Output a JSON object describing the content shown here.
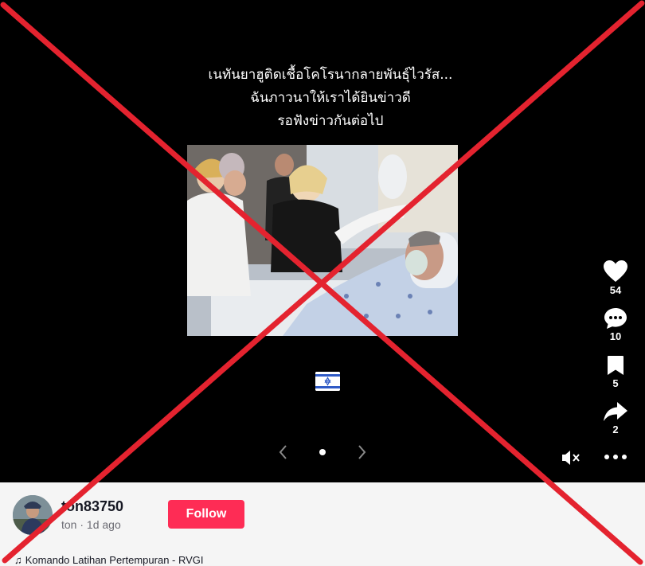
{
  "post": {
    "caption_lines": [
      "เนทันยาฮูติดเชื้อโคโรนากลายพันธุ์ไวรัส...",
      "ฉันภาวนาให้เราได้ยินข่าวดี",
      "รอฟังข่าวกันต่อไป"
    ],
    "flag_icon": "israel-flag-icon"
  },
  "actions": {
    "likes": "54",
    "comments": "10",
    "saves": "5",
    "shares": "2"
  },
  "author": {
    "username": "ton83750",
    "nickname": "ton",
    "separator": " · ",
    "posted": "1d ago",
    "follow_label": "Follow"
  },
  "music": {
    "note_icon": "♫",
    "title": "Komando Latihan Pertempuran - RVGI"
  },
  "colors": {
    "follow": "#fe2c55",
    "cross": "#e4232f",
    "video_bg": "#000000"
  }
}
